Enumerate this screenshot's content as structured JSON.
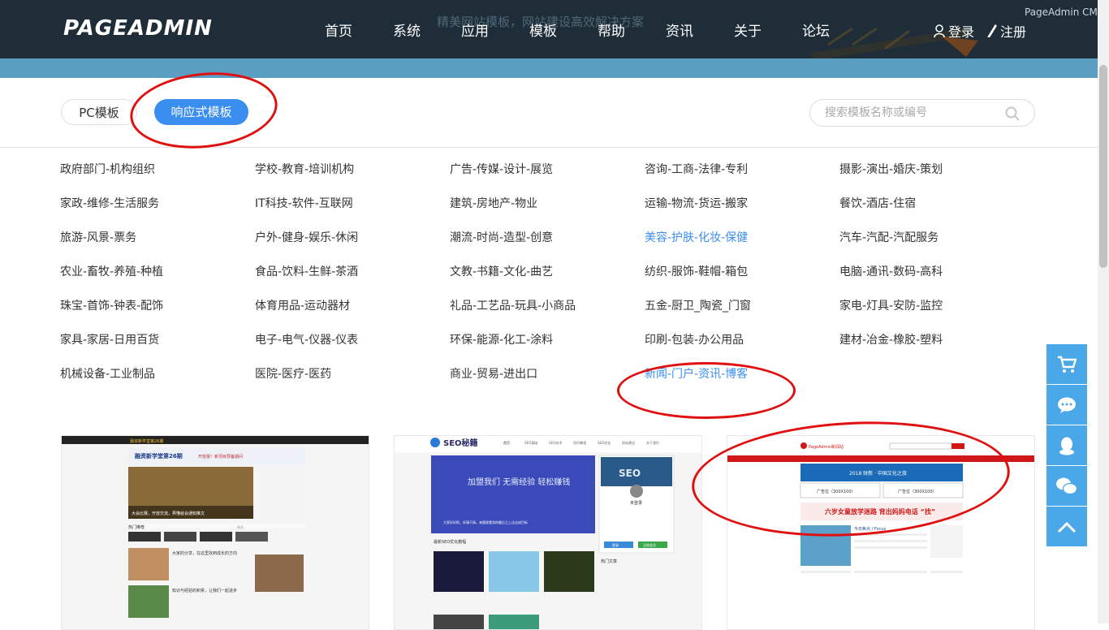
{
  "header": {
    "logo": "PAGEADMIN",
    "slogan": "精美网站模板，网站建设高效解决方案",
    "brand_tag": "PageAdmin CMS",
    "nav": [
      "首页",
      "系统",
      "应用",
      "模板",
      "帮助",
      "资讯",
      "关于",
      "论坛"
    ],
    "login": "登录",
    "register": "注册"
  },
  "filter": {
    "tabs": [
      "PC模板",
      "响应式模板"
    ],
    "active_tab": "响应式模板",
    "search_placeholder": "搜索模板名称或编号"
  },
  "categories": [
    "政府部门-机构组织",
    "学校-教育-培训机构",
    "广告-传媒-设计-展览",
    "咨询-工商-法律-专利",
    "摄影-演出-婚庆-策划",
    "家政-维修-生活服务",
    "IT科技-软件-互联网",
    "建筑-房地产-物业",
    "运输-物流-货运-搬家",
    "餐饮-酒店-住宿",
    "旅游-风景-票务",
    "户外-健身-娱乐-休闲",
    "潮流-时尚-造型-创意",
    "美容-护肤-化妆-保健",
    "汽车-汽配-汽配服务",
    "农业-畜牧-养殖-种植",
    "食品-饮料-生鲜-茶酒",
    "文教-书籍-文化-曲艺",
    "纺织-服饰-鞋帽-箱包",
    "电脑-通讯-数码-高科",
    "珠宝-首饰-钟表-配饰",
    "体育用品-运动器材",
    "礼品-工艺品-玩具-小商品",
    "五金-厨卫_陶瓷_门窗",
    "家电-灯具-安防-监控",
    "家具-家居-日用百货",
    "电子-电气-仪器-仪表",
    "环保-能源-化工-涂料",
    "印刷-包装-办公用品",
    "建材-冶金-橡胶-塑料",
    "机械设备-工业制品",
    "医院-医疗-医药",
    "商业-贸易-进出口",
    "新闻-门户-资讯-博客"
  ],
  "highlighted_categories": [
    "美容-护肤-化妆-保健",
    "新闻-门户-资讯-博客"
  ],
  "cards": [
    {
      "header_tag": "融资新学堂第26期",
      "banner": "融资新学堂第26期",
      "banner_sub": "开放报！新项目预备期间",
      "slide_caption": "大会比赛，开放交流，弄懂就会通知推文",
      "section_title": "热门推荐",
      "more": "更多",
      "item1": "大家的分享，在这里找到成长的方向",
      "item2": "知识与经验的积累，让我们一起进步"
    },
    {
      "logo": "SEO秘籍",
      "nav": [
        "首页",
        "SEO基础",
        "SEO技术",
        "SEO教程",
        "SEO优化",
        "网站建设",
        "关于我们"
      ],
      "banner": "加盟我们 无需经验 轻松赚钱",
      "banner_sub": "大家好好抓，轩辕干搞，来围观看到的最后之上达达成目标",
      "profile": "未登录",
      "btn_login": "登录",
      "btn_register": "注册会员",
      "section_title": "最新SEO优化教程",
      "side_title": "热门文章",
      "thumb_text": "SEO"
    },
    {
      "logo": "PageAdmin新闻站",
      "banner": "2018 财新 · 中国文化之旅",
      "ad1": "广告位（300X100）",
      "ad2": "广告位（300X100）",
      "headline": "六岁女童放学迷路 背出妈妈电话 “找”",
      "focus": "今日焦点 / Focus"
    }
  ]
}
